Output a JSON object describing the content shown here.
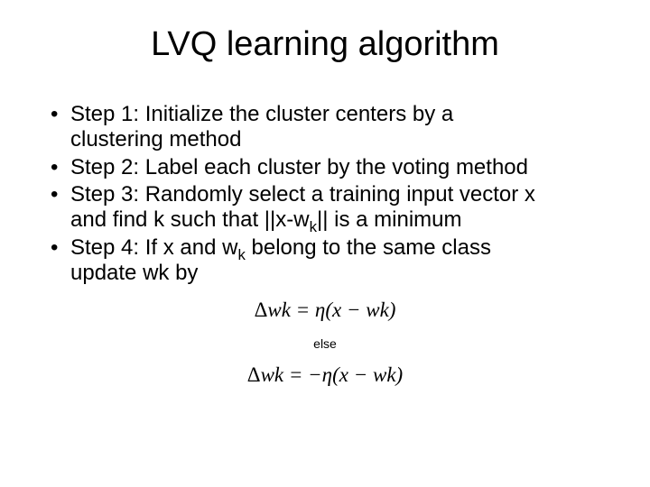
{
  "title": "LVQ learning algorithm",
  "bullets": {
    "step1a": "Step 1: Initialize the cluster centers by a",
    "step1b": "clustering method",
    "step2": "Step 2: Label each cluster by the voting method",
    "step3a": "Step 3: Randomly select a training input vector x",
    "step3b_pre": "and find k such that ||x-w",
    "step3b_sub": "k",
    "step3b_post": "|| is a minimum",
    "step4a_pre": "Step 4: If x and w",
    "step4a_sub": "k",
    "step4a_post": " belong to the same class",
    "step4b": "update wk by"
  },
  "formulas": {
    "f1_delta": "Δ",
    "f1_body": "wk = η(x − wk)",
    "else_label": "else",
    "f2_delta": "Δ",
    "f2_body": "wk = −η(x − wk)"
  }
}
